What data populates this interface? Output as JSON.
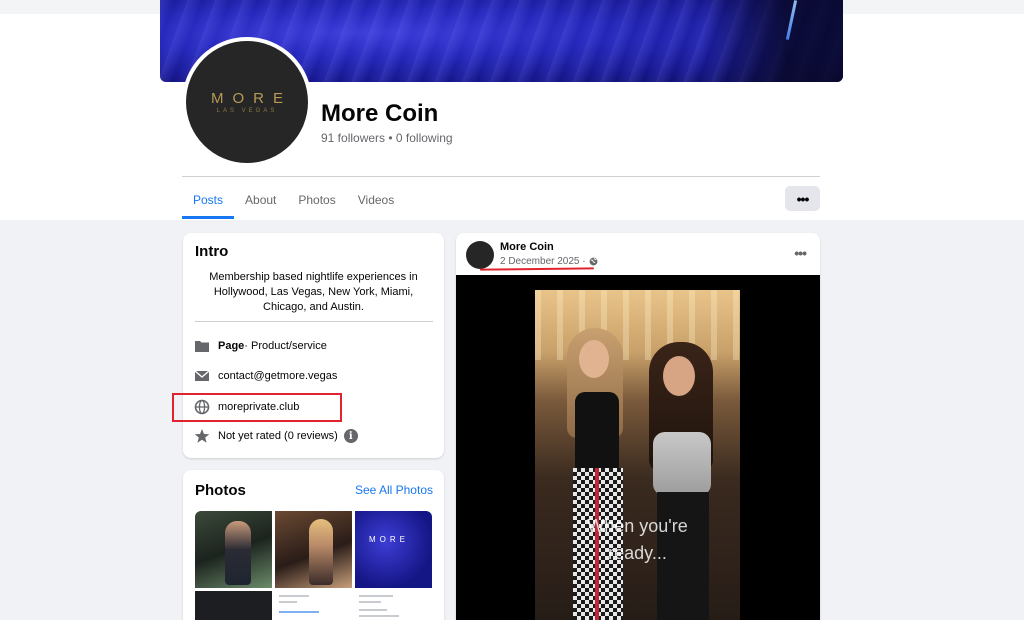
{
  "profile": {
    "avatar_logo_main": "MORE",
    "avatar_logo_sub": "LAS VEGAS",
    "name": "More Coin",
    "followers_line": "91 followers • 0 following"
  },
  "tabs": [
    {
      "label": "Posts",
      "active": true
    },
    {
      "label": "About",
      "active": false
    },
    {
      "label": "Photos",
      "active": false
    },
    {
      "label": "Videos",
      "active": false
    }
  ],
  "more_button_label": "•••",
  "intro": {
    "title": "Intro",
    "bio": "Membership based nightlife experiences in Hollywood, Las Vegas, New York, Miami, Chicago, and Austin.",
    "page_label": "Page",
    "page_category": " · Product/service",
    "email": "contact@getmore.vegas",
    "website": "moreprivate.club",
    "rating": "Not yet rated (0 reviews)",
    "info_icon_text": "i"
  },
  "photos": {
    "title": "Photos",
    "see_all": "See All Photos",
    "thumb3_logo": "MORE"
  },
  "post": {
    "author": "More Coin",
    "date": "2 December 2025 ·",
    "more_label": "•••",
    "overlay_line1": "When you're",
    "overlay_line2": "ready..."
  },
  "colors": {
    "accent": "#1877f2",
    "annotation_red": "#e0232e",
    "logo_gold": "#b79a55"
  },
  "icons": [
    "page-icon",
    "envelope-icon",
    "globe-icon",
    "star-icon",
    "info-icon",
    "privacy-globe-icon"
  ]
}
